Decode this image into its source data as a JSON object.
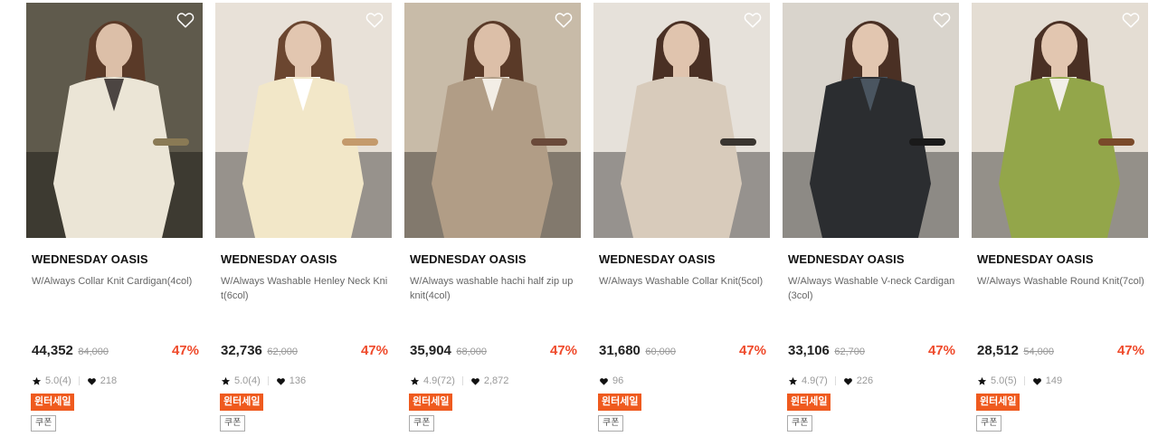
{
  "colors": {
    "discount": "#ef4a2b",
    "sale_tag": "#ef5a1e"
  },
  "products": [
    {
      "brand": "WEDNESDAY OASIS",
      "name": "W/Always Collar Knit Cardigan(4col)",
      "price": "44,352",
      "original_price": "84,000",
      "discount": "47%",
      "rating": "5.0(4)",
      "likes": "218",
      "sale_tag": "윈터세일",
      "coupon_tag": "쿠폰",
      "photo": {
        "bg": "#5f5a4c",
        "garment": "#ebe5d6",
        "inner": "#4c4542",
        "hair": "#5a3a28",
        "skin": "#dcbfa8",
        "accent": "#8a7a55"
      }
    },
    {
      "brand": "WEDNESDAY OASIS",
      "name": "W/Always Washable Henley Neck Knit(6col)",
      "price": "32,736",
      "original_price": "62,000",
      "discount": "47%",
      "rating": "5.0(4)",
      "likes": "136",
      "sale_tag": "윈터세일",
      "coupon_tag": "쿠폰",
      "photo": {
        "bg": "#e8e1d8",
        "garment": "#f2e7c8",
        "inner": "#ffffff",
        "hair": "#6b4630",
        "skin": "#e2c6b0",
        "accent": "#c49a6c"
      }
    },
    {
      "brand": "WEDNESDAY OASIS",
      "name": "W/Always washable hachi half zip up knit(4col)",
      "price": "35,904",
      "original_price": "68,000",
      "discount": "47%",
      "rating": "4.9(72)",
      "likes": "2,872",
      "sale_tag": "윈터세일",
      "coupon_tag": "쿠폰",
      "photo": {
        "bg": "#c8bba8",
        "garment": "#b19d86",
        "inner": "#f3eee6",
        "hair": "#5a3a28",
        "skin": "#dcbfa8",
        "accent": "#6a4a3a"
      }
    },
    {
      "brand": "WEDNESDAY OASIS",
      "name": "W/Always Washable Collar Knit(5col)",
      "price": "31,680",
      "original_price": "60,000",
      "discount": "47%",
      "rating": "",
      "likes": "96",
      "sale_tag": "윈터세일",
      "coupon_tag": "쿠폰",
      "photo": {
        "bg": "#e6e1da",
        "garment": "#d8cbbb",
        "inner": "#d8cbbb",
        "hair": "#4a3024",
        "skin": "#e0c4ae",
        "accent": "#3a3530"
      }
    },
    {
      "brand": "WEDNESDAY OASIS",
      "name": "W/Always Washable V-neck Cardigan(3col)",
      "price": "33,106",
      "original_price": "62,700",
      "discount": "47%",
      "rating": "4.9(7)",
      "likes": "226",
      "sale_tag": "윈터세일",
      "coupon_tag": "쿠폰",
      "photo": {
        "bg": "#d9d4cc",
        "garment": "#2b2d30",
        "inner": "#4a5560",
        "hair": "#4a3024",
        "skin": "#e2c6b0",
        "accent": "#1a1a1a"
      }
    },
    {
      "brand": "WEDNESDAY OASIS",
      "name": "W/Always Washable Round Knit(7col)",
      "price": "28,512",
      "original_price": "54,000",
      "discount": "47%",
      "rating": "5.0(5)",
      "likes": "149",
      "sale_tag": "윈터세일",
      "coupon_tag": "쿠폰",
      "photo": {
        "bg": "#e4ddd3",
        "garment": "#93a64a",
        "inner": "#f2efe8",
        "hair": "#4a3024",
        "skin": "#e2c6b0",
        "accent": "#7a4a2a"
      }
    }
  ]
}
